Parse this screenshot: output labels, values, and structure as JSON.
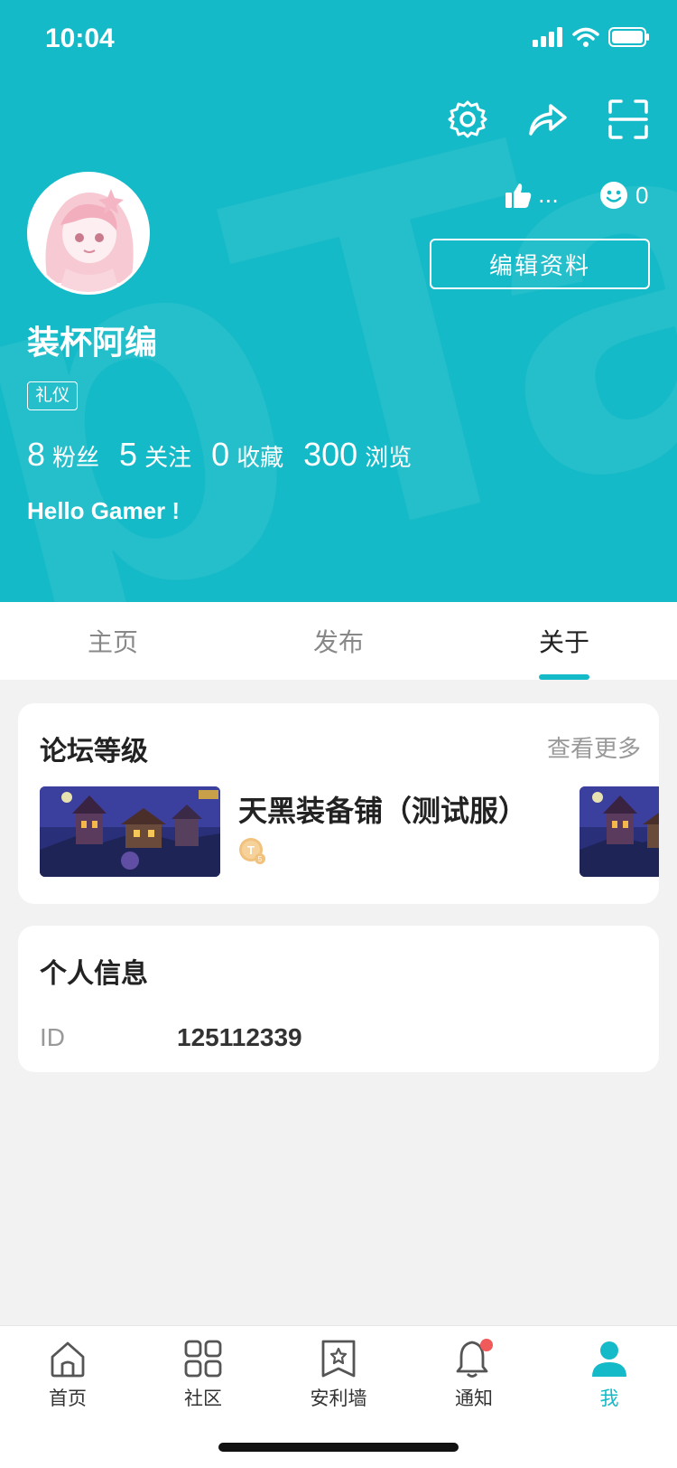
{
  "status_bar": {
    "time": "10:04"
  },
  "profile": {
    "username": "装杯阿编",
    "tag": "礼仪",
    "likes": "...",
    "smiles": "0",
    "edit_label": "编辑资料",
    "bio": "Hello Gamer !",
    "counts": [
      {
        "value": "8",
        "label": "粉丝"
      },
      {
        "value": "5",
        "label": "关注"
      },
      {
        "value": "0",
        "label": "收藏"
      },
      {
        "value": "300",
        "label": "浏览"
      }
    ]
  },
  "tabs": [
    {
      "label": "主页",
      "active": false
    },
    {
      "label": "发布",
      "active": false
    },
    {
      "label": "关于",
      "active": true
    }
  ],
  "forum_level": {
    "title": "论坛等级",
    "more": "查看更多",
    "game_name": "天黑装备铺（测试服）",
    "badge": "T5"
  },
  "personal_info": {
    "title": "个人信息",
    "rows": [
      {
        "key": "ID",
        "value": "125112339"
      }
    ]
  },
  "bottom_nav": [
    {
      "label": "首页",
      "icon": "home-icon",
      "active": false
    },
    {
      "label": "社区",
      "icon": "grid-icon",
      "active": false
    },
    {
      "label": "安利墙",
      "icon": "bookmark-star-icon",
      "active": false
    },
    {
      "label": "通知",
      "icon": "bell-icon",
      "active": false,
      "badge": true
    },
    {
      "label": "我",
      "icon": "person-icon",
      "active": true
    }
  ],
  "colors": {
    "accent": "#15bac8",
    "badge_red": "#f05a5a"
  }
}
